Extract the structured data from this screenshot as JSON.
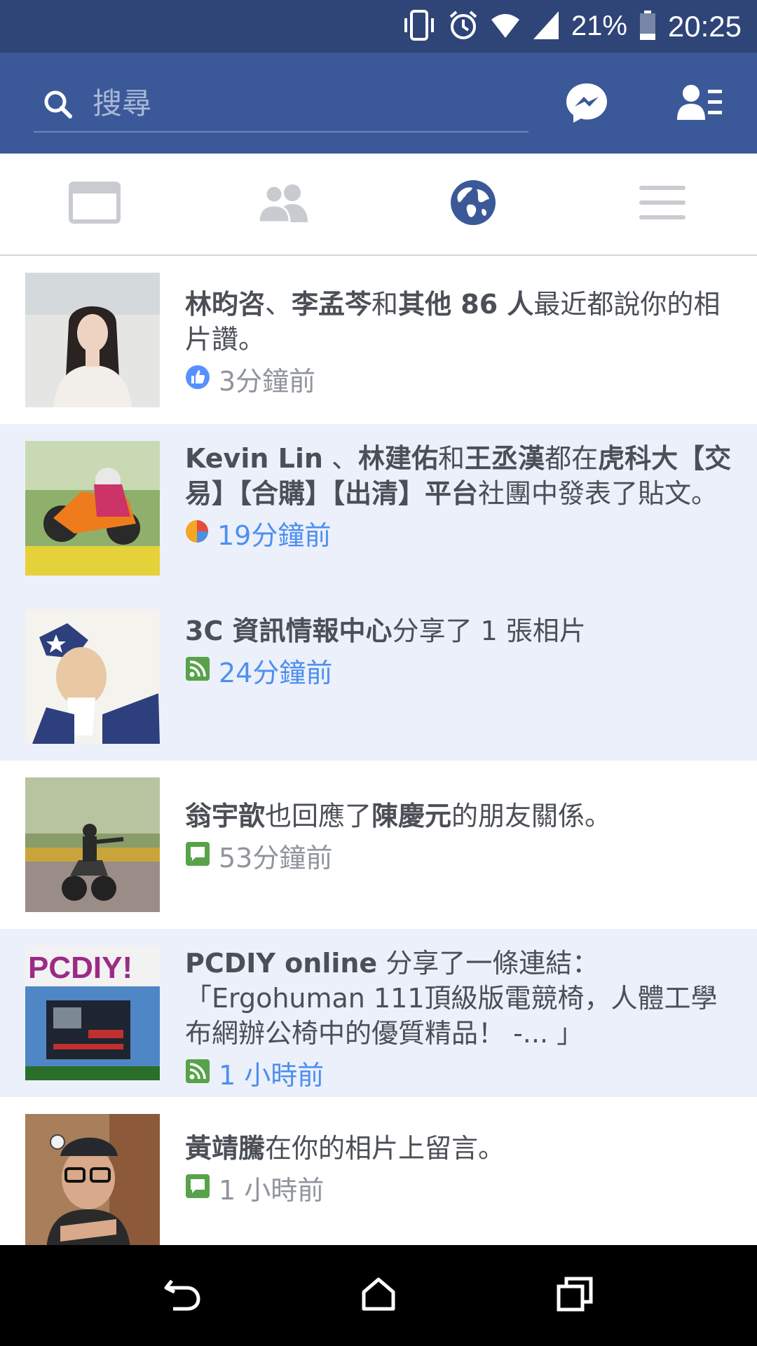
{
  "status_bar": {
    "battery_percent": "21%",
    "time": "20:25"
  },
  "search": {
    "placeholder": "搜尋"
  },
  "tabs": [
    {
      "name": "news-feed",
      "active": false
    },
    {
      "name": "friend-requests",
      "active": false
    },
    {
      "name": "notifications",
      "active": true
    },
    {
      "name": "more",
      "active": false
    }
  ],
  "notifications": [
    {
      "segments": [
        {
          "text": "林昀咨",
          "bold": true
        },
        {
          "text": "、",
          "bold": false
        },
        {
          "text": "李孟芩",
          "bold": true
        },
        {
          "text": "和",
          "bold": false
        },
        {
          "text": "其他 86 人",
          "bold": true
        },
        {
          "text": "最近都說你的相片讚。",
          "bold": false
        }
      ],
      "icon": "like-icon",
      "time": "3分鐘前",
      "unread": false
    },
    {
      "segments": [
        {
          "text": "Kevin Lin",
          "bold": true
        },
        {
          "text": " 、",
          "bold": false
        },
        {
          "text": "林建佑",
          "bold": true
        },
        {
          "text": "和",
          "bold": false
        },
        {
          "text": "王丞漢",
          "bold": true
        },
        {
          "text": "都在",
          "bold": false
        },
        {
          "text": "虎科大【交易】【合購】【出清】平台",
          "bold": true
        },
        {
          "text": "社團中發表了貼文。",
          "bold": false
        }
      ],
      "icon": "group-icon",
      "time": "19分鐘前",
      "unread": true
    },
    {
      "segments": [
        {
          "text": "3C 資訊情報中心",
          "bold": true
        },
        {
          "text": "分享了 1 張相片",
          "bold": false
        }
      ],
      "icon": "feed-icon",
      "time": "24分鐘前",
      "unread": true
    },
    {
      "segments": [
        {
          "text": "翁宇歆",
          "bold": true
        },
        {
          "text": "也回應了",
          "bold": false
        },
        {
          "text": "陳慶元",
          "bold": true
        },
        {
          "text": "的朋友關係。",
          "bold": false
        }
      ],
      "icon": "comment-icon",
      "time": "53分鐘前",
      "unread": false
    },
    {
      "segments": [
        {
          "text": "PCDIY online",
          "bold": true
        },
        {
          "text": " 分享了一條連結：「Ergohuman 111頂級版電競椅，人體工學布網辦公椅中的優質精品！ -... 」",
          "bold": false
        }
      ],
      "icon": "feed-icon",
      "time": "1 小時前",
      "unread": true
    },
    {
      "segments": [
        {
          "text": "黃靖騰",
          "bold": true
        },
        {
          "text": "在你的相片上留言。",
          "bold": false
        }
      ],
      "icon": "comment-icon",
      "time": "1 小時前",
      "unread": false
    }
  ],
  "thumbnail_text": {
    "pcdiy": "PCDIY!"
  },
  "colors": {
    "brand": "#3b5998",
    "status_bar": "#2f4477",
    "unread_bg": "#ecf0fb",
    "unread_time": "#4d8ff0",
    "read_time": "#90949c",
    "body_text": "#4b4f56"
  }
}
